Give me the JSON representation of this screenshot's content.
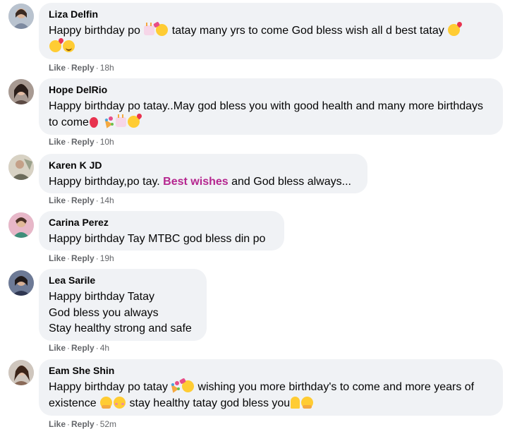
{
  "comments": [
    {
      "name": "Liza Delfin",
      "text_parts": [
        "Happy birthday po ",
        "tatay many yrs to come God bless wish all d best tatay "
      ],
      "time": "18h"
    },
    {
      "name": "Hope DelRio",
      "text_parts": [
        "Happy birthday po tatay..May god bless you with good health and many more birthdays to come"
      ],
      "time": "10h"
    },
    {
      "name": "Karen K JD",
      "text_parts": [
        "Happy birthday,po tay. ",
        "Best wishes",
        " and God bless always..."
      ],
      "time": "14h"
    },
    {
      "name": "Carina Perez",
      "text_parts": [
        "Happy birthday Tay MTBC god bless din po"
      ],
      "time": "19h"
    },
    {
      "name": "Lea Sarile",
      "text_parts": [
        "Happy birthday Tatay\nGod bless you always\nStay healthy strong and safe"
      ],
      "time": "4h"
    },
    {
      "name": "Eam She Shin",
      "text_parts": [
        "Happy birthday po tatay",
        " wishing you more birthday's to come and more years of existence ",
        " stay healthy tatay god bless you"
      ],
      "time": "52m"
    }
  ],
  "actions": {
    "like_label": "Like",
    "reply_label": "Reply",
    "separator": "·"
  },
  "colors": {
    "bubble_bg": "#f0f2f5",
    "meta_text": "#65676b",
    "highlight": "#b5268f"
  }
}
